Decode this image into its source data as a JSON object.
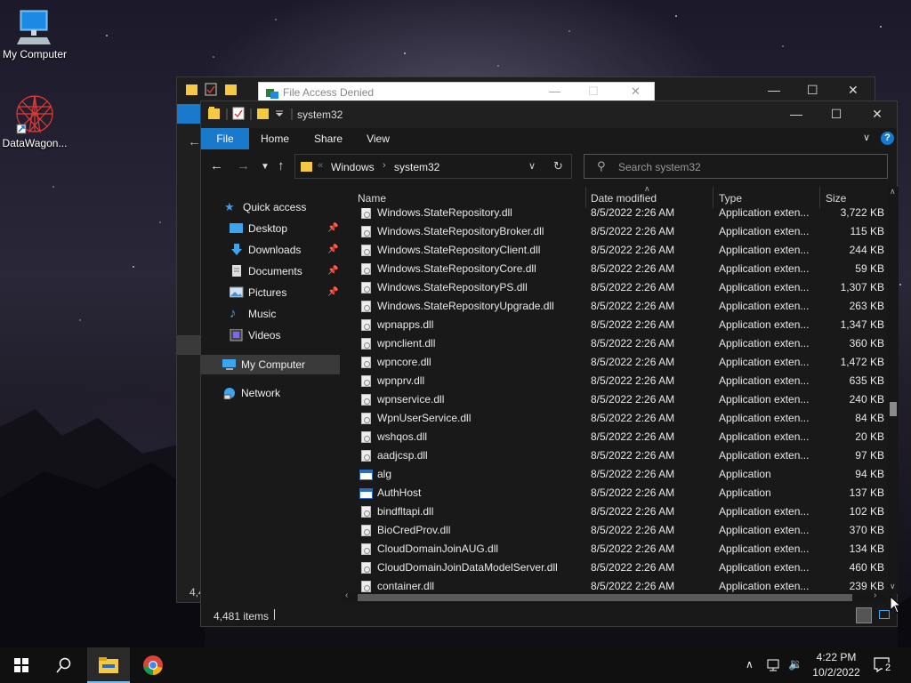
{
  "desktop": {
    "icons": [
      {
        "label": "My Computer"
      },
      {
        "label": "DataWagon..."
      }
    ]
  },
  "back_window": {
    "dialog_title": "File Access Denied"
  },
  "explorer": {
    "title": "system32",
    "ribbon_tabs": [
      "File",
      "Home",
      "Share",
      "View"
    ],
    "address": {
      "crumbs": [
        "Windows",
        "system32"
      ]
    },
    "search_placeholder": "Search system32",
    "nav": {
      "quick_access": "Quick access",
      "items": [
        {
          "label": "Desktop",
          "icon": "desktop-icon",
          "pinned": true
        },
        {
          "label": "Downloads",
          "icon": "downloads-icon",
          "pinned": true
        },
        {
          "label": "Documents",
          "icon": "documents-icon",
          "pinned": true
        },
        {
          "label": "Pictures",
          "icon": "pictures-icon",
          "pinned": true
        },
        {
          "label": "Music",
          "icon": "music-icon",
          "pinned": false
        },
        {
          "label": "Videos",
          "icon": "videos-icon",
          "pinned": false
        }
      ],
      "this_pc": "My Computer",
      "network": "Network"
    },
    "columns": {
      "name": "Name",
      "date": "Date modified",
      "type": "Type",
      "size": "Size"
    },
    "files": [
      {
        "name": "Windows.StateRepository.dll",
        "date": "8/5/2022 2:26 AM",
        "type": "Application exten...",
        "size": "3,722 KB",
        "kind": "dll"
      },
      {
        "name": "Windows.StateRepositoryBroker.dll",
        "date": "8/5/2022 2:26 AM",
        "type": "Application exten...",
        "size": "115 KB",
        "kind": "dll"
      },
      {
        "name": "Windows.StateRepositoryClient.dll",
        "date": "8/5/2022 2:26 AM",
        "type": "Application exten...",
        "size": "244 KB",
        "kind": "dll"
      },
      {
        "name": "Windows.StateRepositoryCore.dll",
        "date": "8/5/2022 2:26 AM",
        "type": "Application exten...",
        "size": "59 KB",
        "kind": "dll"
      },
      {
        "name": "Windows.StateRepositoryPS.dll",
        "date": "8/5/2022 2:26 AM",
        "type": "Application exten...",
        "size": "1,307 KB",
        "kind": "dll"
      },
      {
        "name": "Windows.StateRepositoryUpgrade.dll",
        "date": "8/5/2022 2:26 AM",
        "type": "Application exten...",
        "size": "263 KB",
        "kind": "dll"
      },
      {
        "name": "wpnapps.dll",
        "date": "8/5/2022 2:26 AM",
        "type": "Application exten...",
        "size": "1,347 KB",
        "kind": "dll"
      },
      {
        "name": "wpnclient.dll",
        "date": "8/5/2022 2:26 AM",
        "type": "Application exten...",
        "size": "360 KB",
        "kind": "dll"
      },
      {
        "name": "wpncore.dll",
        "date": "8/5/2022 2:26 AM",
        "type": "Application exten...",
        "size": "1,472 KB",
        "kind": "dll"
      },
      {
        "name": "wpnprv.dll",
        "date": "8/5/2022 2:26 AM",
        "type": "Application exten...",
        "size": "635 KB",
        "kind": "dll"
      },
      {
        "name": "wpnservice.dll",
        "date": "8/5/2022 2:26 AM",
        "type": "Application exten...",
        "size": "240 KB",
        "kind": "dll"
      },
      {
        "name": "WpnUserService.dll",
        "date": "8/5/2022 2:26 AM",
        "type": "Application exten...",
        "size": "84 KB",
        "kind": "dll"
      },
      {
        "name": "wshqos.dll",
        "date": "8/5/2022 2:26 AM",
        "type": "Application exten...",
        "size": "20 KB",
        "kind": "dll"
      },
      {
        "name": "aadjcsp.dll",
        "date": "8/5/2022 2:26 AM",
        "type": "Application exten...",
        "size": "97 KB",
        "kind": "dll"
      },
      {
        "name": "alg",
        "date": "8/5/2022 2:26 AM",
        "type": "Application",
        "size": "94 KB",
        "kind": "app"
      },
      {
        "name": "AuthHost",
        "date": "8/5/2022 2:26 AM",
        "type": "Application",
        "size": "137 KB",
        "kind": "app"
      },
      {
        "name": "bindfltapi.dll",
        "date": "8/5/2022 2:26 AM",
        "type": "Application exten...",
        "size": "102 KB",
        "kind": "dll"
      },
      {
        "name": "BioCredProv.dll",
        "date": "8/5/2022 2:26 AM",
        "type": "Application exten...",
        "size": "370 KB",
        "kind": "dll"
      },
      {
        "name": "CloudDomainJoinAUG.dll",
        "date": "8/5/2022 2:26 AM",
        "type": "Application exten...",
        "size": "134 KB",
        "kind": "dll"
      },
      {
        "name": "CloudDomainJoinDataModelServer.dll",
        "date": "8/5/2022 2:26 AM",
        "type": "Application exten...",
        "size": "460 KB",
        "kind": "dll"
      },
      {
        "name": "container.dll",
        "date": "8/5/2022 2:26 AM",
        "type": "Application exten...",
        "size": "239 KB",
        "kind": "dll"
      }
    ],
    "status": {
      "item_count": "4,481 items"
    }
  },
  "back_status": "4,4",
  "taskbar": {
    "time": "4:22 PM",
    "date": "10/2/2022",
    "notification_count": "2"
  },
  "colors": {
    "accent": "#1979ca",
    "window_bg": "#191919",
    "taskbar_bg": "#101010"
  }
}
